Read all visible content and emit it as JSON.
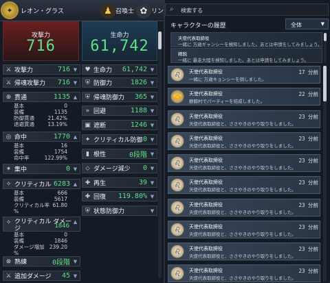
{
  "header": {
    "character_name": "レオン・グラス",
    "class_name": "召喚士",
    "pet_name": "リン",
    "emblem_icon": "emblem-icon",
    "class_icon": "summoner-icon",
    "pet_icon": "pet-icon"
  },
  "summary": {
    "attack_label": "攻撃力",
    "attack_value": "716",
    "hp_label": "生命力",
    "hp_value": "61,742"
  },
  "left_stats": [
    {
      "icon": "sword-icon",
      "label": "攻撃力",
      "value": "716"
    },
    {
      "icon": "sword-icon",
      "label": "帰魂攻撃力",
      "value": "716"
    },
    {
      "icon": "pierce-icon",
      "label": "貫通",
      "value": "1135"
    },
    {
      "icon": "hit-icon",
      "label": "命中",
      "value": "1770"
    },
    {
      "icon": "focus-icon",
      "label": "集中",
      "value": "0"
    },
    {
      "icon": "critical-icon",
      "label": "クリティカル",
      "value": "6283"
    },
    {
      "icon": "critical-damage-icon",
      "label": "クリティカル ダメージ",
      "value": "1846"
    },
    {
      "icon": "mastery-icon",
      "label": "熟練",
      "value": "0段階"
    },
    {
      "icon": "extra-damage-icon",
      "label": "追加ダメージ",
      "value": "45"
    }
  ],
  "pierce_details": [
    {
      "k": "基本",
      "v": "0"
    },
    {
      "k": "装備",
      "v": "1135"
    },
    {
      "k": "防御貫通",
      "v": "21.42%"
    },
    {
      "k": "退避貫通",
      "v": "13.19%"
    }
  ],
  "hit_details": [
    {
      "k": "基本",
      "v": "16"
    },
    {
      "k": "装備",
      "v": "1754"
    },
    {
      "k": "命中率",
      "v": "122.99%"
    }
  ],
  "critical_details": [
    {
      "k": "基本",
      "v": "666"
    },
    {
      "k": "装備",
      "v": "5617"
    },
    {
      "k": "クリティカル率",
      "v": "61.80"
    },
    {
      "k": "%",
      "v": ""
    }
  ],
  "critdmg_details": [
    {
      "k": "基本",
      "v": "0"
    },
    {
      "k": "装備",
      "v": "1846"
    },
    {
      "k": "ダメージ増加",
      "v": "239.20"
    },
    {
      "k": "%",
      "v": ""
    }
  ],
  "right_stats": [
    {
      "icon": "heart-icon",
      "label": "生命力",
      "value": "61,742"
    },
    {
      "icon": "shield-icon",
      "label": "防御力",
      "value": "1826"
    },
    {
      "icon": "shield-icon",
      "label": "帰魂防御力",
      "value": "365"
    },
    {
      "icon": "evade-icon",
      "label": "回避",
      "value": "1188"
    },
    {
      "icon": "block-icon",
      "label": "遮断",
      "value": "1246"
    },
    {
      "icon": "critical-defense-icon",
      "label": "クリティカル防御",
      "value": "0"
    },
    {
      "icon": "tenacity-icon",
      "label": "根性",
      "value": "0段階"
    },
    {
      "icon": "damage-reduction-icon",
      "label": "ダメージ減少",
      "value": "0"
    },
    {
      "icon": "regen-icon",
      "label": "再生",
      "value": "39"
    },
    {
      "icon": "recovery-icon",
      "label": "回復",
      "value": "119.80%"
    },
    {
      "icon": "status-defense-icon",
      "label": "状態防御力",
      "value": ""
    }
  ],
  "search": {
    "placeholder": "検索する"
  },
  "history": {
    "title": "キャラクターの履歴",
    "filter_value": "全体",
    "items": [
      {
        "title": "天使代表取締役",
        "subtitle": "一緒に 万歳ギャンシーを検知しました。あとは申請をしてみましょう。"
      },
      {
        "title": "精鋭",
        "subtitle": "一緒に 暴走大陸を検知しました。あとは申請をしてみましょう。"
      }
    ]
  },
  "notifications": [
    {
      "title": "天使代表取締役",
      "subtitle": "一緒に 万歳キョンシーを倒しました。",
      "time": "17 分前"
    },
    {
      "title": "天使代表取締役",
      "subtitle": "静鯨村でパーティーを結成しました。",
      "time": "22 分前"
    },
    {
      "title": "天使代表取締役",
      "subtitle": "天使代表取締役と、ささやきのやり取りをしました。",
      "time": "23 分前"
    },
    {
      "title": "天使代表取締役",
      "subtitle": "天使代表取締役と、ささやきのやり取りをしました。",
      "time": "23 分前"
    },
    {
      "title": "天使代表取締役",
      "subtitle": "天使代表取締役と、ささやきのやり取りをしました。",
      "time": "23 分前"
    },
    {
      "title": "天使代表取締役",
      "subtitle": "天使代表取締役と、ささやきのやり取りをしました。",
      "time": "23 分前"
    },
    {
      "title": "天使代表取締役",
      "subtitle": "天使代表取締役と、ささやきのやり取りをしました。",
      "time": "23 分前"
    },
    {
      "title": "天使代表取締役",
      "subtitle": "天使代表取締役と、ささやきのやり取りをしました。",
      "time": "23 分前"
    },
    {
      "title": "天使代表取締役",
      "subtitle": "天使代表取締役と、ささやきのやり取りをしました。",
      "time": "23 分前"
    },
    {
      "title": "天使代表取締役",
      "subtitle": "天使代表取締役と、ささやきのやり取りをしました。",
      "time": "23 分前"
    }
  ],
  "colors": {
    "value_green": "#5fe08a",
    "attack_red": "#6a1e1e",
    "hp_blue": "#1d3c55"
  }
}
